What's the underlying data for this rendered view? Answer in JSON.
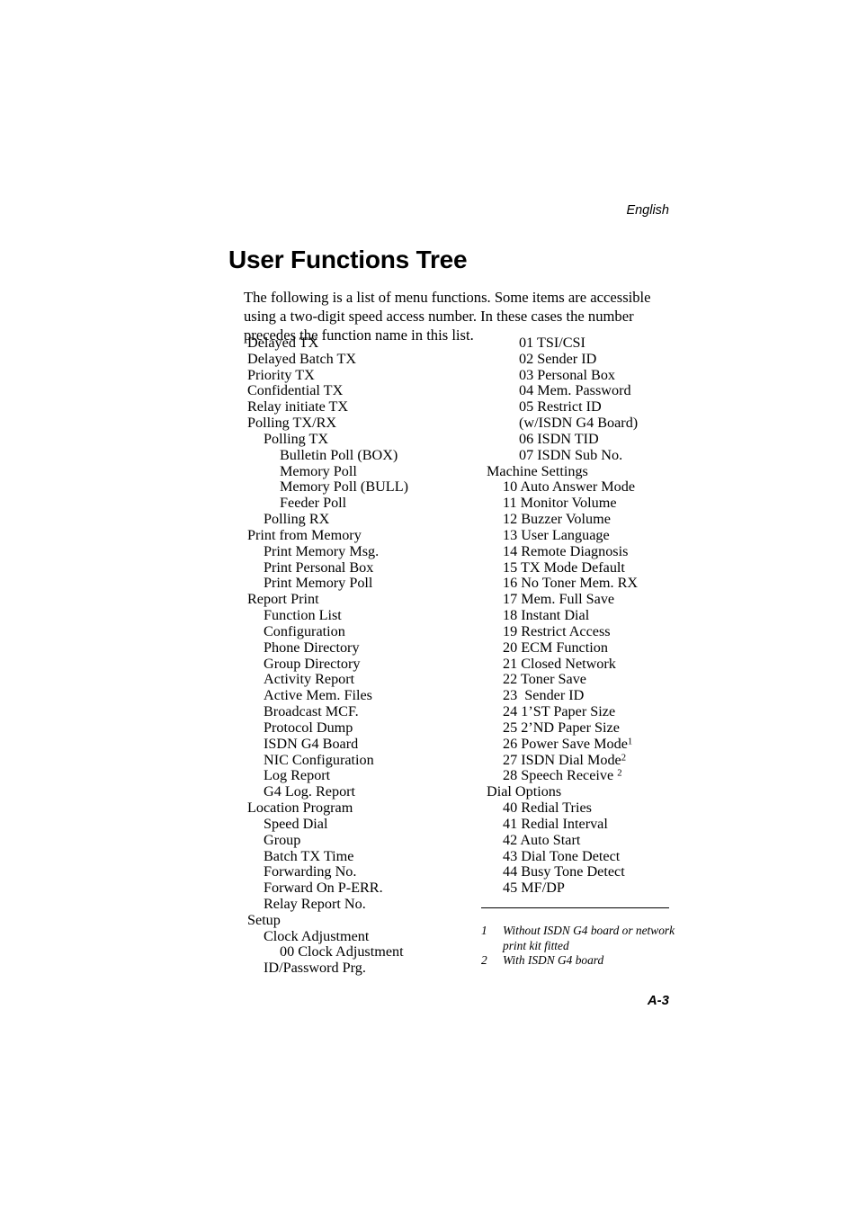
{
  "header": {
    "language_label": "English",
    "title": "User Functions Tree"
  },
  "intro": {
    "paragraph": "The following is a list of menu functions. Some items are accessible using a two-digit speed access number. In these cases the number precedes the function name in this list."
  },
  "columns": {
    "left": [
      {
        "label": "Delayed TX",
        "level": 0
      },
      {
        "label": "Delayed Batch TX",
        "level": 0
      },
      {
        "label": "Priority TX",
        "level": 0
      },
      {
        "label": "Confidential TX",
        "level": 0
      },
      {
        "label": "Relay initiate TX",
        "level": 0
      },
      {
        "label": "Polling TX/RX",
        "level": 0
      },
      {
        "label": "Polling TX",
        "level": 1
      },
      {
        "label": "Bulletin Poll (BOX)",
        "level": 2
      },
      {
        "label": "Memory Poll",
        "level": 2
      },
      {
        "label": "Memory Poll (BULL)",
        "level": 2
      },
      {
        "label": "Feeder Poll",
        "level": 2
      },
      {
        "label": "Polling RX",
        "level": 1
      },
      {
        "label": "Print from Memory",
        "level": 0
      },
      {
        "label": "Print Memory Msg.",
        "level": 1
      },
      {
        "label": "Print Personal Box",
        "level": 1
      },
      {
        "label": "Print Memory Poll",
        "level": 1
      },
      {
        "label": "Report Print",
        "level": 0
      },
      {
        "label": "Function List",
        "level": 1
      },
      {
        "label": "Configuration",
        "level": 1
      },
      {
        "label": "Phone Directory",
        "level": 1
      },
      {
        "label": "Group Directory",
        "level": 1
      },
      {
        "label": "Activity Report",
        "level": 1
      },
      {
        "label": "Active Mem. Files",
        "level": 1
      },
      {
        "label": "Broadcast MCF.",
        "level": 1
      },
      {
        "label": "Protocol Dump",
        "level": 1
      },
      {
        "label": "ISDN G4 Board",
        "level": 1
      },
      {
        "label": "NIC Configuration",
        "level": 1
      },
      {
        "label": "Log Report",
        "level": 1
      },
      {
        "label": "G4 Log. Report",
        "level": 1
      },
      {
        "label": "Location Program",
        "level": 0
      },
      {
        "label": "Speed Dial",
        "level": 1
      },
      {
        "label": "Group",
        "level": 1
      },
      {
        "label": "Batch TX Time",
        "level": 1
      },
      {
        "label": "Forwarding No.",
        "level": 1
      },
      {
        "label": "Forward On P-ERR.",
        "level": 1
      },
      {
        "label": "Relay Report No.",
        "level": 1
      },
      {
        "label": "Setup",
        "level": 0
      },
      {
        "label": "Clock Adjustment",
        "level": 1
      },
      {
        "label": "00 Clock Adjustment",
        "level": 2
      },
      {
        "label": "ID/Password Prg.",
        "level": 1
      }
    ],
    "right": [
      {
        "label": "01 TSI/CSI",
        "level": 2
      },
      {
        "label": "02 Sender ID",
        "level": 2
      },
      {
        "label": "03 Personal Box",
        "level": 2
      },
      {
        "label": "04 Mem. Password",
        "level": 2
      },
      {
        "label": "05 Restrict ID",
        "level": 2
      },
      {
        "label": "(w/ISDN G4 Board)",
        "level": 2
      },
      {
        "label": "06 ISDN TID",
        "level": 2
      },
      {
        "label": "07 ISDN Sub No.",
        "level": 2
      },
      {
        "label": "Machine Settings",
        "level": 0
      },
      {
        "label": "10 Auto Answer Mode",
        "level": 1
      },
      {
        "label": "11 Monitor Volume",
        "level": 1
      },
      {
        "label": "12 Buzzer Volume",
        "level": 1
      },
      {
        "label": "13 User Language",
        "level": 1
      },
      {
        "label": "14 Remote Diagnosis",
        "level": 1
      },
      {
        "label": "15 TX Mode Default",
        "level": 1
      },
      {
        "label": "16 No Toner Mem. RX",
        "level": 1
      },
      {
        "label": "17 Mem. Full Save",
        "level": 1
      },
      {
        "label": "18 Instant Dial",
        "level": 1
      },
      {
        "label": "19 Restrict Access",
        "level": 1
      },
      {
        "label": "20 ECM Function",
        "level": 1
      },
      {
        "label": "21 Closed Network",
        "level": 1
      },
      {
        "label": "22 Toner Save",
        "level": 1
      },
      {
        "label": "23  Sender ID",
        "level": 1
      },
      {
        "label": "24 1’ST Paper Size",
        "level": 1
      },
      {
        "label": "25 2’ND Paper Size",
        "level": 1
      },
      {
        "label": "26 Power Save Mode",
        "level": 1,
        "footnote": "1"
      },
      {
        "label": "27 ISDN Dial Mode",
        "level": 1,
        "footnote": "2"
      },
      {
        "label": "28 Speech Receive ",
        "level": 1,
        "footnote": "2"
      },
      {
        "label": "Dial Options",
        "level": 0
      },
      {
        "label": "40 Redial Tries",
        "level": 1
      },
      {
        "label": "41 Redial Interval",
        "level": 1
      },
      {
        "label": "42 Auto Start",
        "level": 1
      },
      {
        "label": "43 Dial Tone Detect",
        "level": 1
      },
      {
        "label": "44 Busy Tone Detect",
        "level": 1
      },
      {
        "label": "45 MF/DP",
        "level": 1
      }
    ]
  },
  "footnotes": [
    {
      "marker": "1",
      "text": "Without ISDN G4 board or network print kit fitted"
    },
    {
      "marker": "2",
      "text": "With ISDN G4 board"
    }
  ],
  "folio": {
    "page_number": "A-3"
  }
}
